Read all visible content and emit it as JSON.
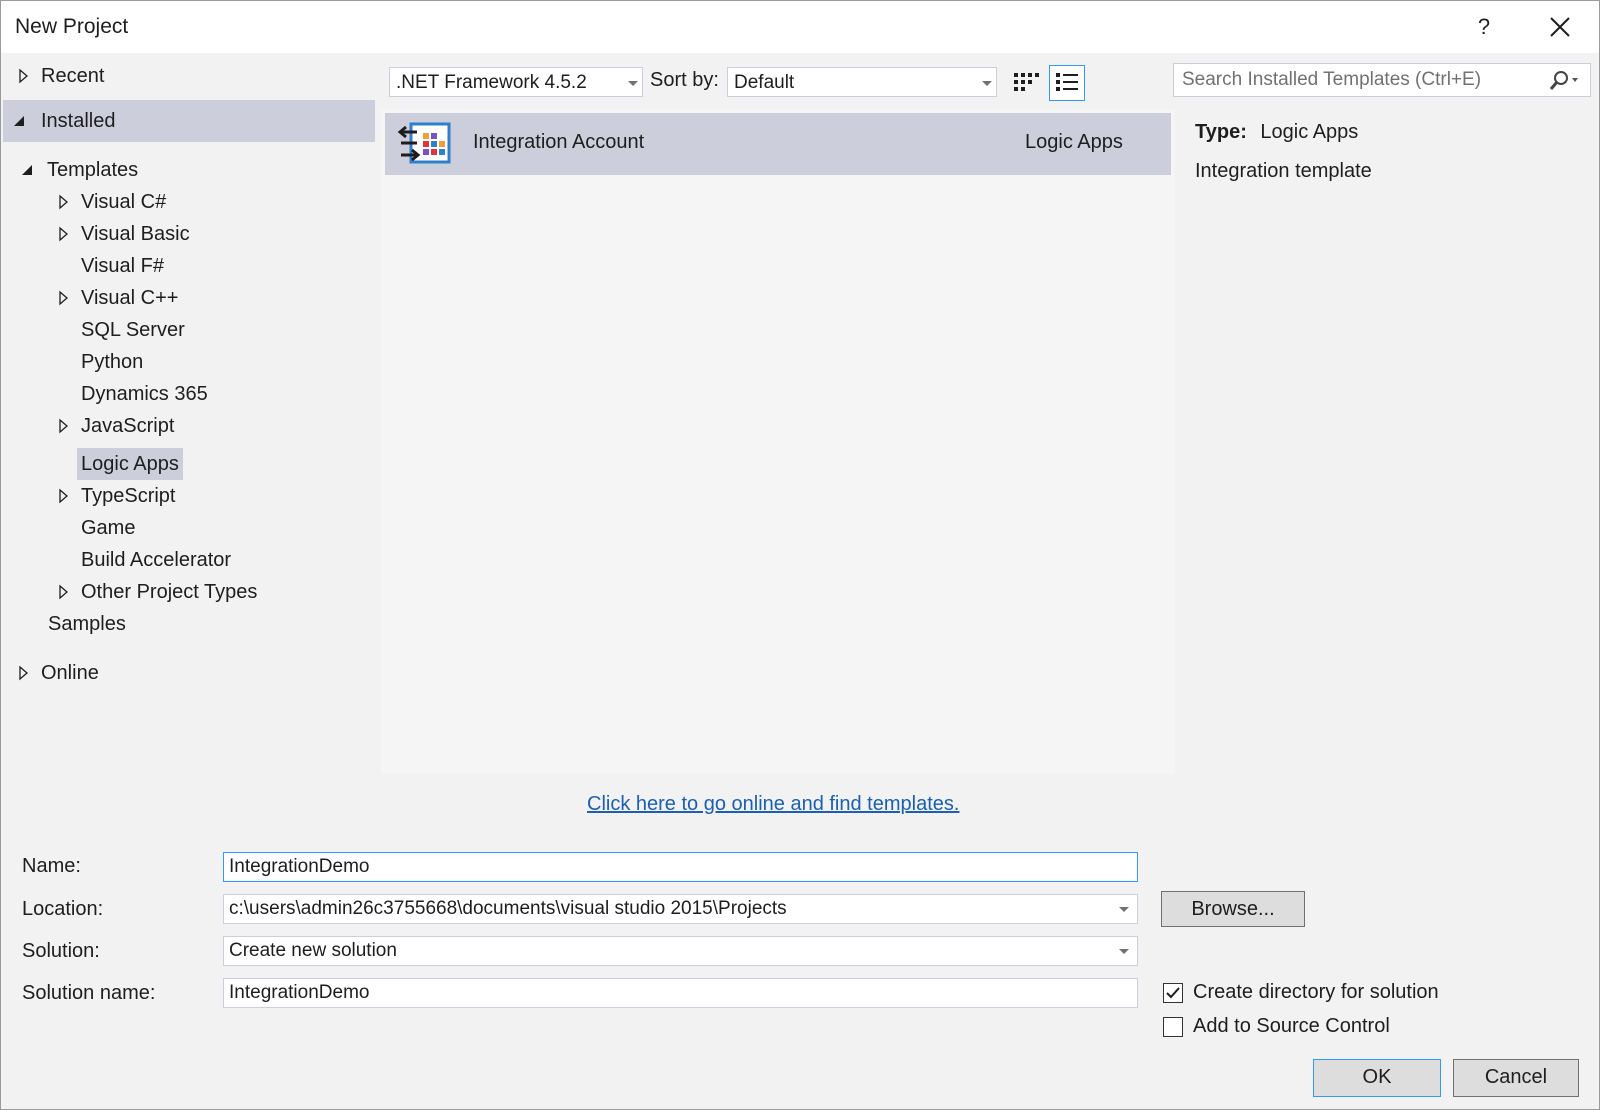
{
  "window": {
    "title": "New Project",
    "help_label": "?"
  },
  "tree": {
    "recent": "Recent",
    "installed": "Installed",
    "templates": "Templates",
    "items": [
      {
        "label": "Visual C#",
        "expandable": true
      },
      {
        "label": "Visual Basic",
        "expandable": true
      },
      {
        "label": "Visual F#",
        "expandable": false
      },
      {
        "label": "Visual C++",
        "expandable": true
      },
      {
        "label": "SQL Server",
        "expandable": false
      },
      {
        "label": "Python",
        "expandable": false
      },
      {
        "label": "Dynamics 365",
        "expandable": false
      },
      {
        "label": "JavaScript",
        "expandable": true
      },
      {
        "label": "Logic Apps",
        "expandable": false,
        "selected": true
      },
      {
        "label": "TypeScript",
        "expandable": true
      },
      {
        "label": "Game",
        "expandable": false
      },
      {
        "label": "Build Accelerator",
        "expandable": false
      },
      {
        "label": "Other Project Types",
        "expandable": true
      }
    ],
    "samples": "Samples",
    "online": "Online"
  },
  "toolbar": {
    "framework": ".NET Framework 4.5.2",
    "sort_label": "Sort by:",
    "sort_value": "Default",
    "small_icons_view": "grid-view-icon",
    "list_view": "list-view-icon"
  },
  "search": {
    "placeholder": "Search Installed Templates (Ctrl+E)",
    "icon": "search-icon"
  },
  "templates": [
    {
      "name": "Integration Account",
      "category": "Logic Apps",
      "icon": "integration-account-icon"
    }
  ],
  "details": {
    "type_label": "Type:",
    "type_value": "Logic Apps",
    "description": "Integration template"
  },
  "online_link": "Click here to go online and find templates.",
  "form": {
    "name_label": "Name:",
    "name_value": "IntegrationDemo",
    "location_label": "Location:",
    "location_value": "c:\\users\\admin26c3755668\\documents\\visual studio 2015\\Projects",
    "solution_label": "Solution:",
    "solution_value": "Create new solution",
    "solution_name_label": "Solution name:",
    "solution_name_value": "IntegrationDemo",
    "browse_label": "Browse...",
    "create_dir_label": "Create directory for solution",
    "create_dir_checked": true,
    "source_control_label": "Add to Source Control",
    "source_control_checked": false
  },
  "buttons": {
    "ok": "OK",
    "cancel": "Cancel"
  },
  "colors": {
    "selection": "#cccedb",
    "link": "#1a5fb4",
    "focus": "#3399ff",
    "background": "#f2f2f3"
  }
}
